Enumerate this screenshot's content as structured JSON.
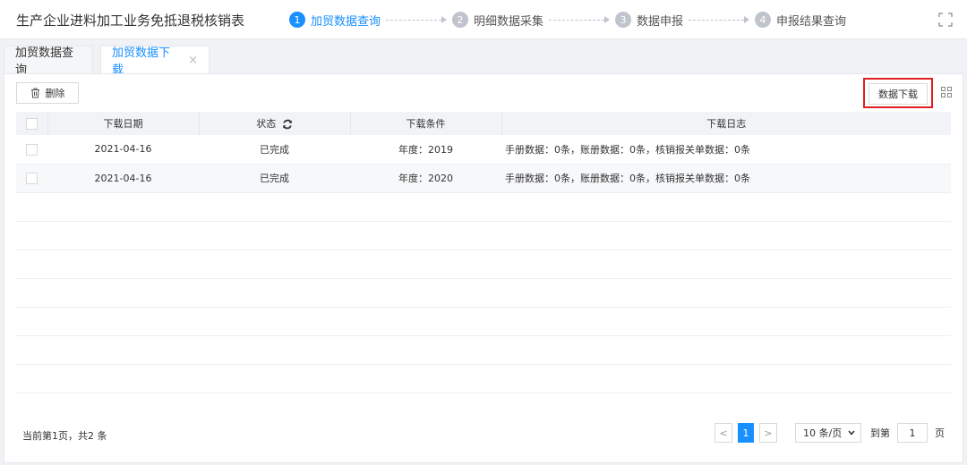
{
  "header": {
    "title": "生产企业进料加工业务免抵退税核销表",
    "steps": [
      {
        "num": "1",
        "label": "加贸数据查询",
        "active": true
      },
      {
        "num": "2",
        "label": "明细数据采集"
      },
      {
        "num": "3",
        "label": "数据申报"
      },
      {
        "num": "4",
        "label": "申报结果查询"
      }
    ],
    "expand_icon": "expand-icon"
  },
  "tabs": [
    {
      "label": "加贸数据查询"
    },
    {
      "label": "加贸数据下载",
      "active": true,
      "close": "×"
    }
  ],
  "toolbar": {
    "delete_label": "删除",
    "download_label": "数据下载",
    "accent": "#1890ff",
    "highlight_color": "#e02020"
  },
  "table": {
    "columns": [
      "下载日期",
      "状态",
      "下载条件",
      "下载日志"
    ],
    "rows": [
      {
        "date": "2021-04-16",
        "status": "已完成",
        "condition": "年度：2019",
        "log": "手册数据：0条，账册数据：0条，核销报关单数据：0条"
      },
      {
        "date": "2021-04-16",
        "status": "已完成",
        "condition": "年度：2020",
        "log": "手册数据：0条，账册数据：0条，核销报关单数据：0条"
      }
    ]
  },
  "footer": {
    "summary": "当前第1页，共2 条",
    "prev": "<",
    "current_page": "1",
    "next": ">",
    "page_size": "10 条/页",
    "goto_label": "到第",
    "goto_value": "1",
    "page_unit": "页"
  }
}
